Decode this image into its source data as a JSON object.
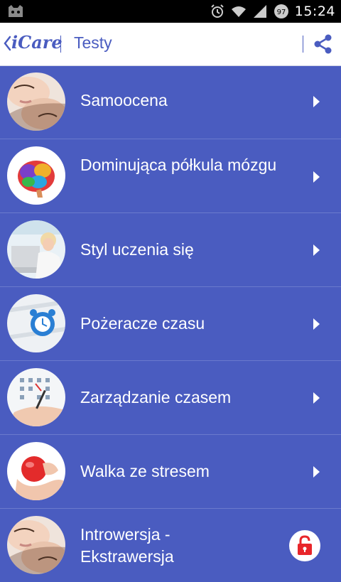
{
  "status_bar": {
    "time": "15:24",
    "battery_level": "97"
  },
  "app_bar": {
    "brand": "iCare",
    "title": "Testy"
  },
  "tests": [
    {
      "label": "Samoocena"
    },
    {
      "label": "Dominująca półkula mózgu"
    },
    {
      "label": "Styl uczenia się"
    },
    {
      "label": "Pożeracze czasu"
    },
    {
      "label": "Zarządzanie czasem"
    },
    {
      "label": "Walka ze stresem"
    },
    {
      "label": "Introwersja - Ekstrawersja",
      "locked": true
    }
  ],
  "icons": {
    "back": "chevron-left-icon",
    "share": "share-icon",
    "row_arrow": "chevron-right-icon",
    "locked": "padlock-icon"
  },
  "colors": {
    "list_background": "#4a5cc0",
    "app_bar_background": "#ffffff",
    "brand": "#4a5cc0",
    "lock_icon": "#e8262a"
  }
}
